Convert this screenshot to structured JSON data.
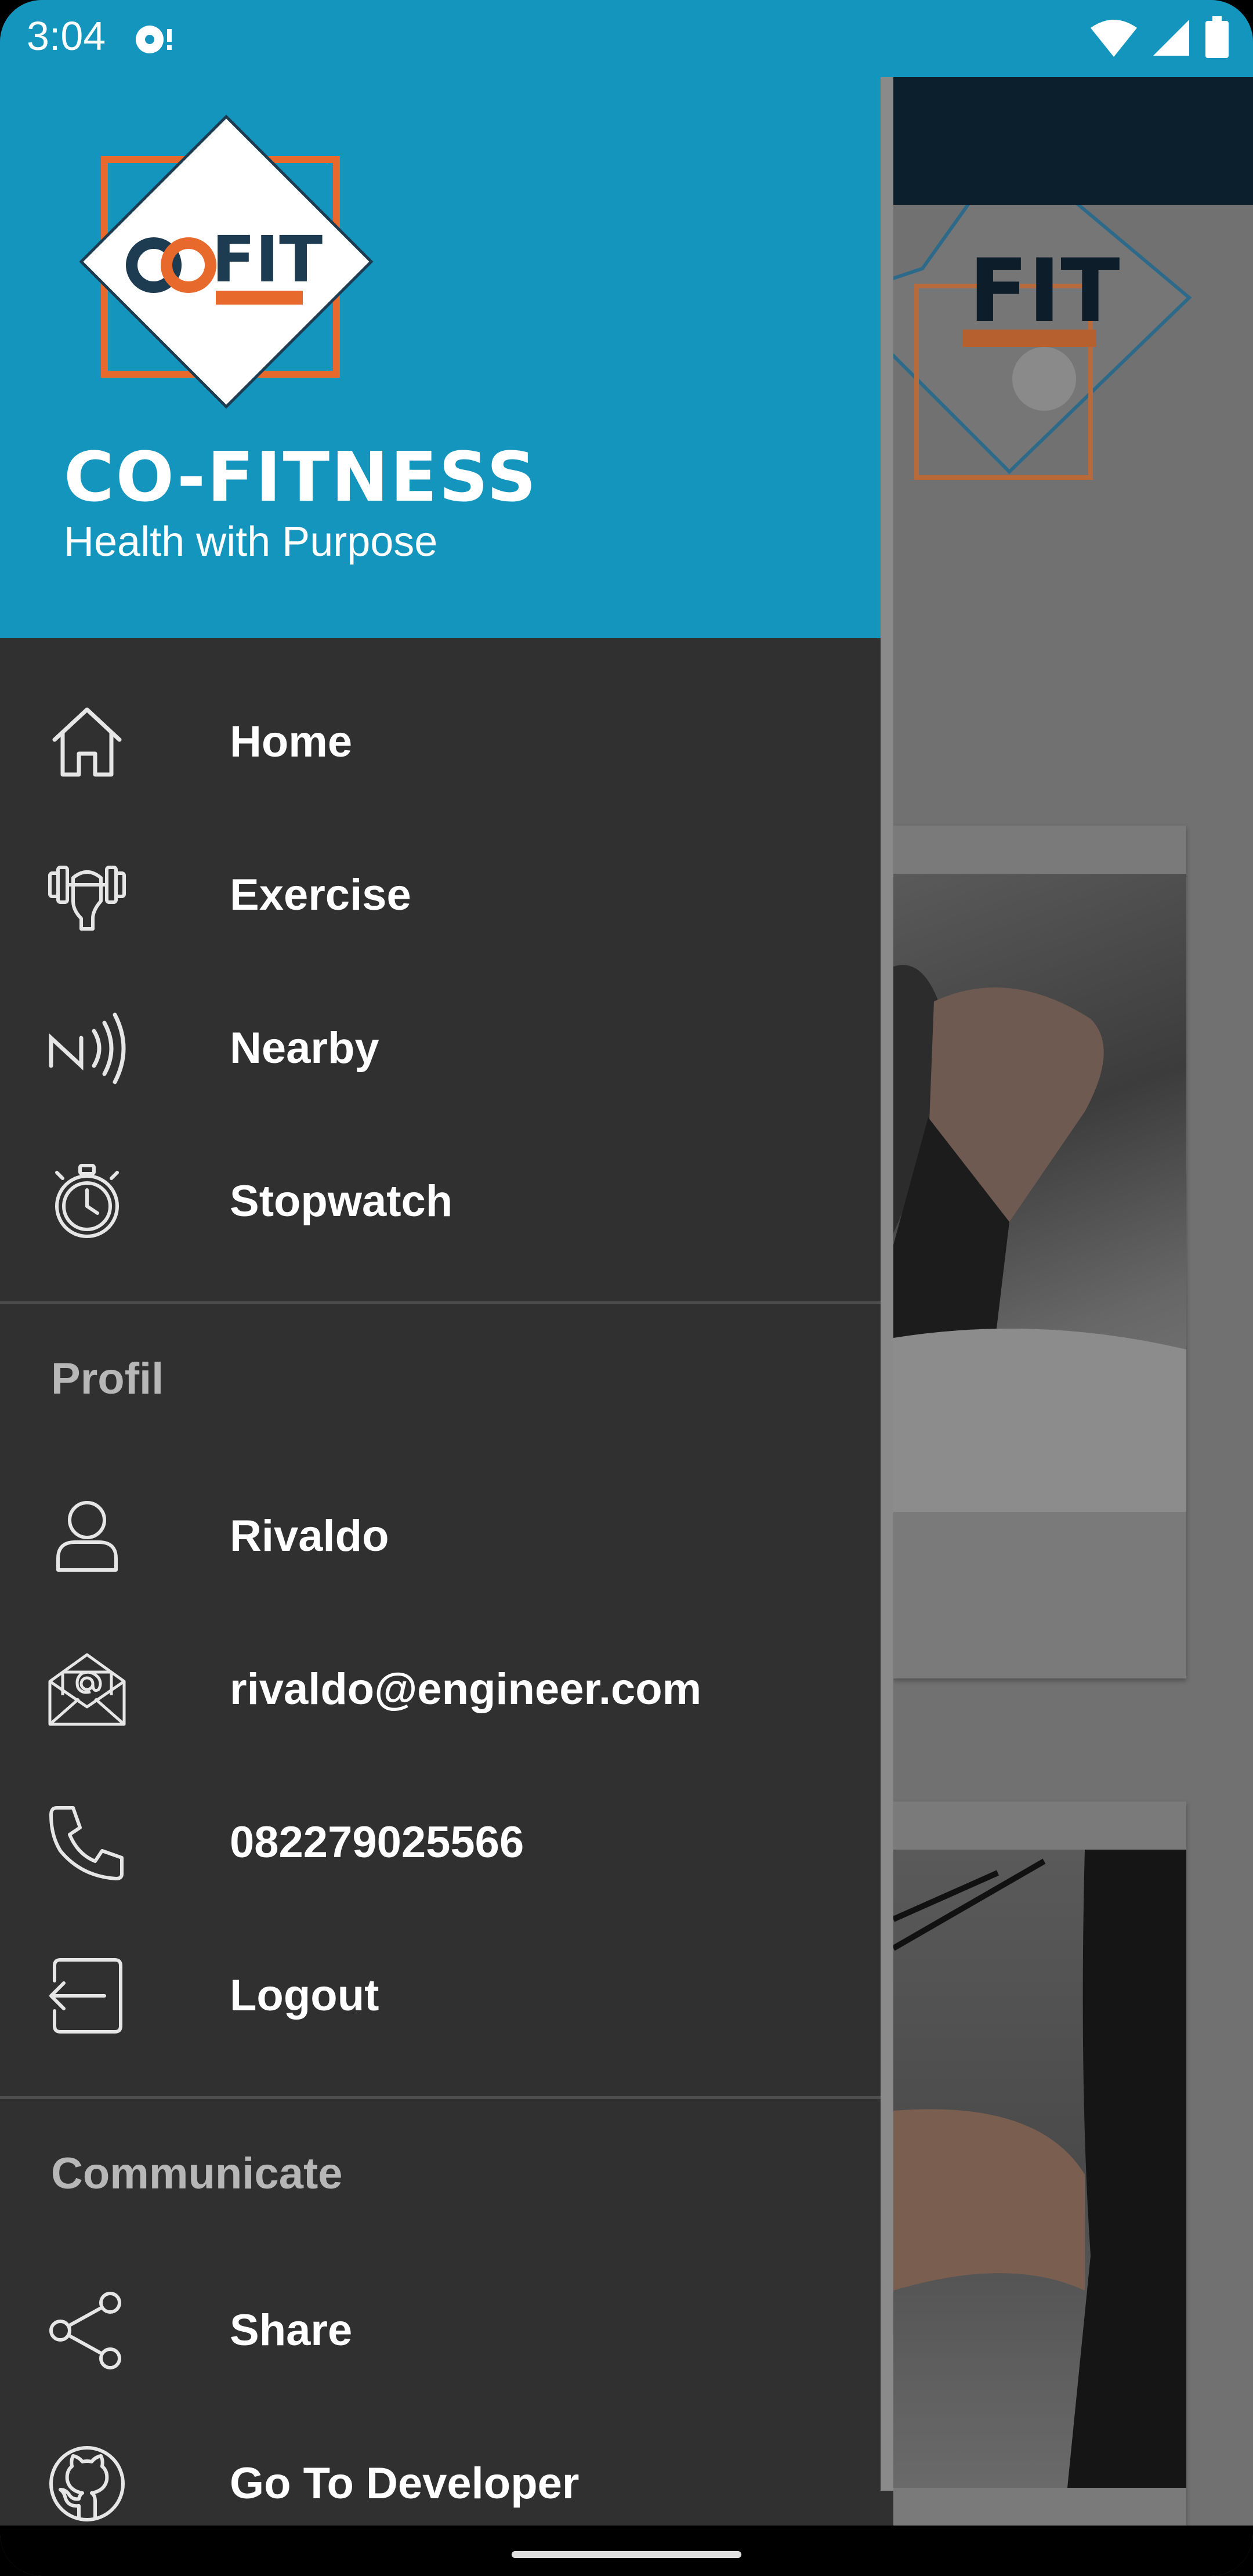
{
  "status_bar": {
    "time": "3:04"
  },
  "header": {
    "app_name": "CO-FITNESS",
    "tagline": "Health with Purpose",
    "logo_text": "FIT"
  },
  "menu": {
    "main": [
      {
        "label": "Home",
        "icon": "home-icon"
      },
      {
        "label": "Exercise",
        "icon": "dumbbell-icon"
      },
      {
        "label": "Nearby",
        "icon": "nfc-icon"
      },
      {
        "label": "Stopwatch",
        "icon": "stopwatch-icon"
      }
    ],
    "profile_title": "Profil",
    "profile": [
      {
        "label": "Rivaldo",
        "icon": "user-icon"
      },
      {
        "label": "rivaldo@engineer.com",
        "icon": "email-icon"
      },
      {
        "label": "082279025566",
        "icon": "phone-icon"
      },
      {
        "label": "Logout",
        "icon": "logout-icon"
      }
    ],
    "communicate_title": "Communicate",
    "communicate": [
      {
        "label": "Share",
        "icon": "share-icon"
      },
      {
        "label": "Go To Developer",
        "icon": "github-icon"
      }
    ]
  },
  "colors": {
    "header_bg": "#1395bd",
    "drawer_bg": "#303030",
    "logo_orange": "#e8692c",
    "logo_navy": "#1d3c52"
  }
}
